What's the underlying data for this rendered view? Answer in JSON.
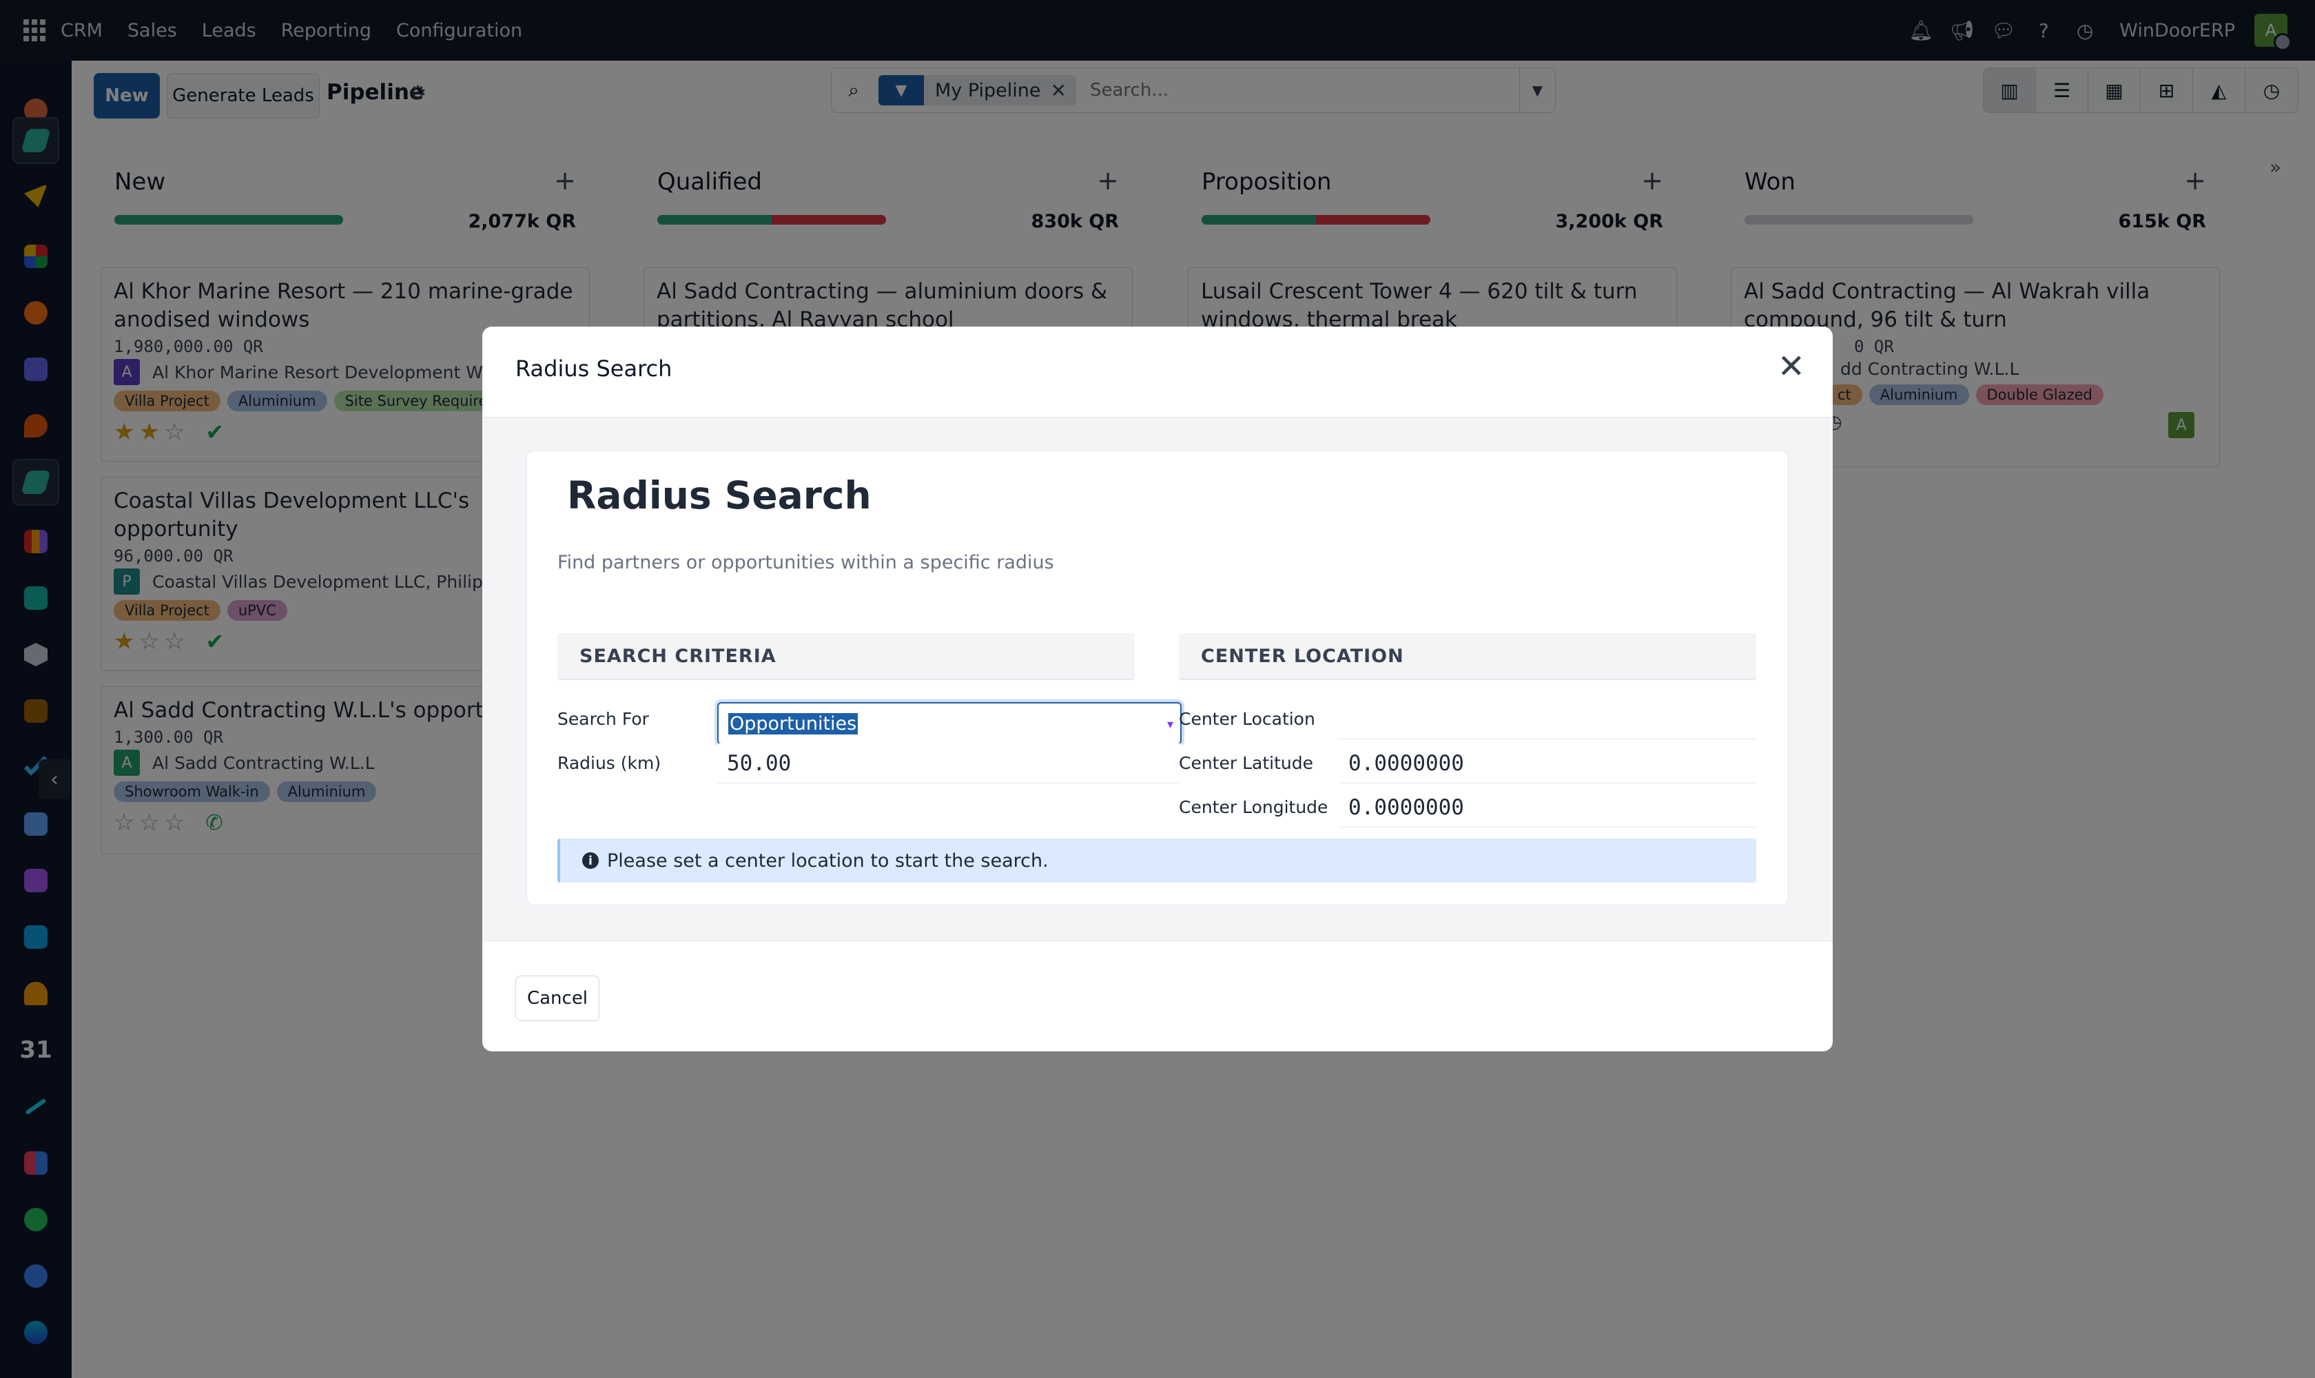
{
  "topbar": {
    "menu": [
      "CRM",
      "Sales",
      "Leads",
      "Reporting",
      "Configuration"
    ],
    "company": "WinDoorERP",
    "user_initial": "A",
    "icons": [
      "bell-icon",
      "megaphone-icon",
      "chat-icon",
      "help-icon",
      "clock-icon"
    ]
  },
  "control": {
    "new_label": "New",
    "generate_label": "Generate Leads",
    "title": "Pipeline",
    "facet_label": "My Pipeline",
    "search_placeholder": "Search..."
  },
  "columns": [
    {
      "title": "New",
      "total": "2,077k QR",
      "progress": {
        "green": 1.0,
        "red": 0.0
      }
    },
    {
      "title": "Qualified",
      "total": "830k QR",
      "progress": {
        "green": 0.5,
        "red": 0.5
      }
    },
    {
      "title": "Proposition",
      "total": "3,200k QR",
      "progress": {
        "green": 0.5,
        "red": 0.5
      }
    },
    {
      "title": "Won",
      "total": "615k QR",
      "progress": {
        "green": 0.0,
        "red": 0.0
      }
    }
  ],
  "cards": {
    "new": [
      {
        "title": "Al Khor Marine Resort — 210 marine-grade anodised windows",
        "amount": "1,980,000.00 QR",
        "partner": "Al Khor Marine Resort Development W.L.L",
        "initial": "A",
        "tags": [
          "Villa Project",
          "Aluminium",
          "Site Survey Required"
        ],
        "stars": 2
      },
      {
        "title": "Coastal Villas Development LLC's opportunity",
        "amount": "96,000.00 QR",
        "partner": "Coastal Villas Development LLC, Philip H",
        "initial": "P",
        "tags": [
          "Villa Project",
          "uPVC"
        ],
        "stars": 1
      },
      {
        "title": "Al Sadd Contracting W.L.L's opportunity",
        "amount": "1,300.00 QR",
        "partner": "Al Sadd Contracting W.L.L",
        "initial": "A",
        "tags": [
          "Showroom Walk-in",
          "Aluminium"
        ],
        "stars": 0
      }
    ],
    "qualified": [
      {
        "title": "Al Sadd Contracting — aluminium doors & partitions, Al Rayyan school"
      }
    ],
    "proposition": [
      {
        "title": "Lusail Crescent Tower 4 — 620 tilt & turn windows, thermal break"
      }
    ],
    "won": [
      {
        "title": "Al Sadd Contracting — Al Wakrah villa compound, 96 tilt & turn",
        "amount": "0 QR",
        "partner": "dd Contracting W.L.L",
        "initial": "A",
        "tags": [
          "ct",
          "Aluminium",
          "Double Glazed"
        ]
      }
    ]
  },
  "modal": {
    "title": "Radius Search",
    "heading": "Radius Search",
    "subtitle": "Find partners or opportunities within a specific radius",
    "criteria_header": "SEARCH CRITERIA",
    "location_header": "CENTER LOCATION",
    "search_for_label": "Search For",
    "search_for_value": "Opportunities",
    "radius_label": "Radius (km)",
    "radius_value": "50.00",
    "center_location_label": "Center Location",
    "center_location_value": "",
    "center_lat_label": "Center Latitude",
    "center_lat_value": "0.0000000",
    "center_lng_label": "Center Longitude",
    "center_lng_value": "0.0000000",
    "alert": "Please set a center location to start the search.",
    "cancel_label": "Cancel"
  },
  "colors": {
    "primary": "#1d5fa8",
    "topbar": "#111827",
    "sidebar": "#0f172a",
    "alert_bg": "#dbeafe"
  }
}
